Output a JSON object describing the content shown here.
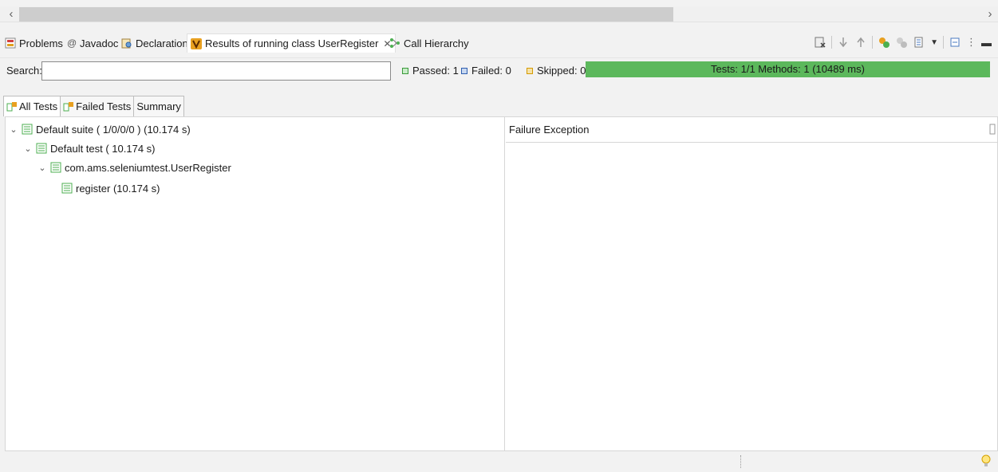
{
  "view_tabs": {
    "problems": "Problems",
    "javadoc": "Javadoc",
    "declaration": "Declaration",
    "results": "Results of running class UserRegister",
    "call_hierarchy": "Call Hierarchy"
  },
  "search": {
    "label": "Search:",
    "value": ""
  },
  "counters": {
    "passed": "Passed: 1",
    "failed": "Failed: 0",
    "skipped": "Skipped: 0"
  },
  "progress": {
    "text": "Tests: 1/1  Methods: 1 (10489 ms)",
    "fraction": 1.0
  },
  "result_tabs": {
    "all": "All Tests",
    "failed": "Failed Tests",
    "summary": "Summary"
  },
  "tree": [
    {
      "label": "Default suite ( 1/0/0/0 ) (10.174 s)"
    },
    {
      "label": "Default test ( 10.174 s)"
    },
    {
      "label": "com.ams.seleniumtest.UserRegister"
    },
    {
      "label": "register  (10.174 s)"
    }
  ],
  "failure_panel": {
    "title": "Failure Exception"
  },
  "colors": {
    "progress_green": "#5cb85c",
    "passed": "#3a9a3a",
    "failed": "#2f5fb0",
    "skipped": "#d49a00"
  }
}
